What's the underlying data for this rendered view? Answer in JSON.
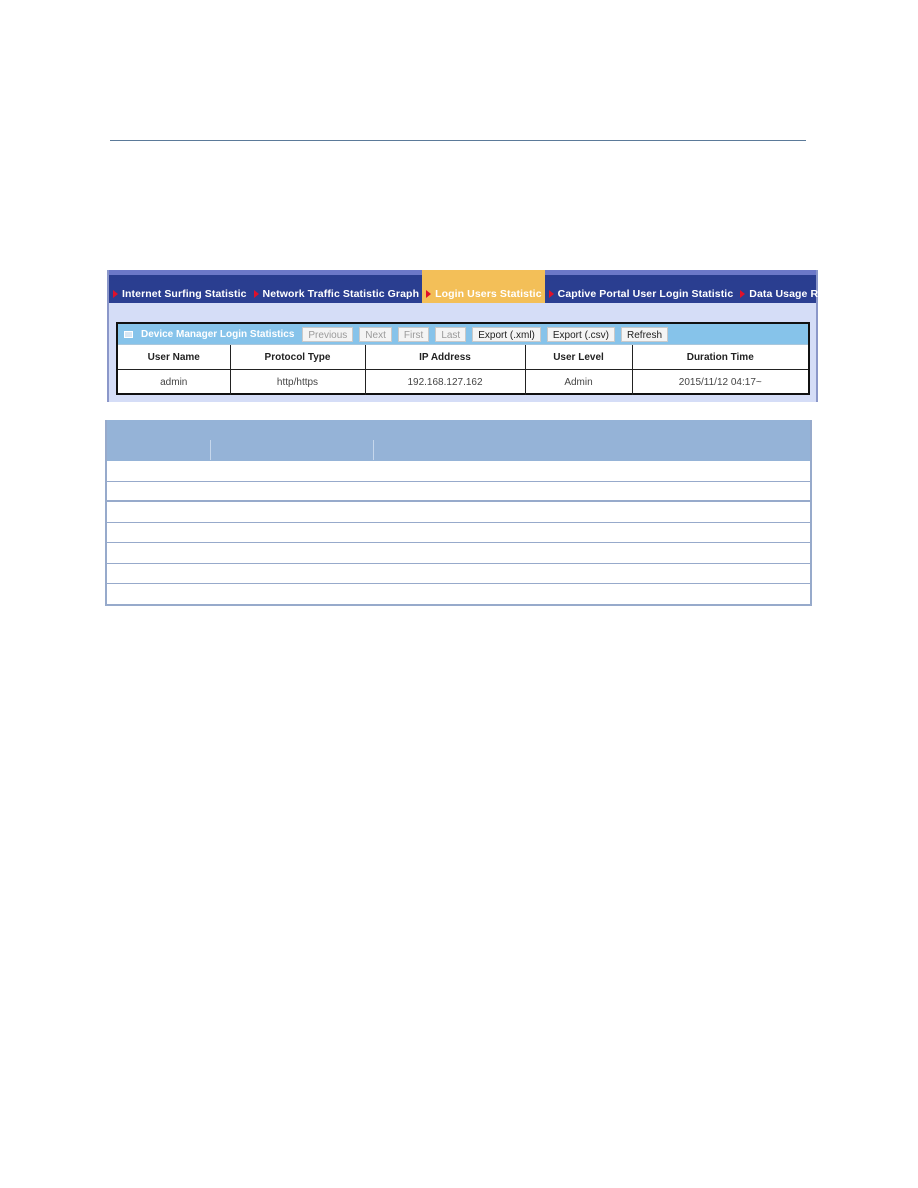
{
  "tabs": [
    {
      "label": "Internet Surfing Statistic",
      "active": false
    },
    {
      "label": "Network Traffic Statistic Graph",
      "active": false
    },
    {
      "label": "Login Users Statistic",
      "active": true
    },
    {
      "label": "Captive Portal User Login Statistic",
      "active": false
    },
    {
      "label": "Data Usage Record",
      "active": false
    }
  ],
  "panel": {
    "title": "Device Manager Login Statistics",
    "buttons": {
      "previous": "Previous",
      "next": "Next",
      "first": "First",
      "last": "Last",
      "export_xml": "Export (.xml)",
      "export_csv": "Export (.csv)",
      "refresh": "Refresh"
    },
    "columns": [
      "User Name",
      "Protocol Type",
      "IP Address",
      "User Level",
      "Duration Time"
    ],
    "rows": [
      [
        "admin",
        "http/https",
        "192.168.127.162",
        "Admin",
        "2015/11/12 04:17~"
      ]
    ]
  },
  "colors": {
    "tab_bar": "#2b3f92",
    "active_tab": "#f3bf58",
    "tab_arrow": "#e0102a",
    "toolbar": "#86c3ea",
    "doc_table_header": "#95b3d7"
  }
}
